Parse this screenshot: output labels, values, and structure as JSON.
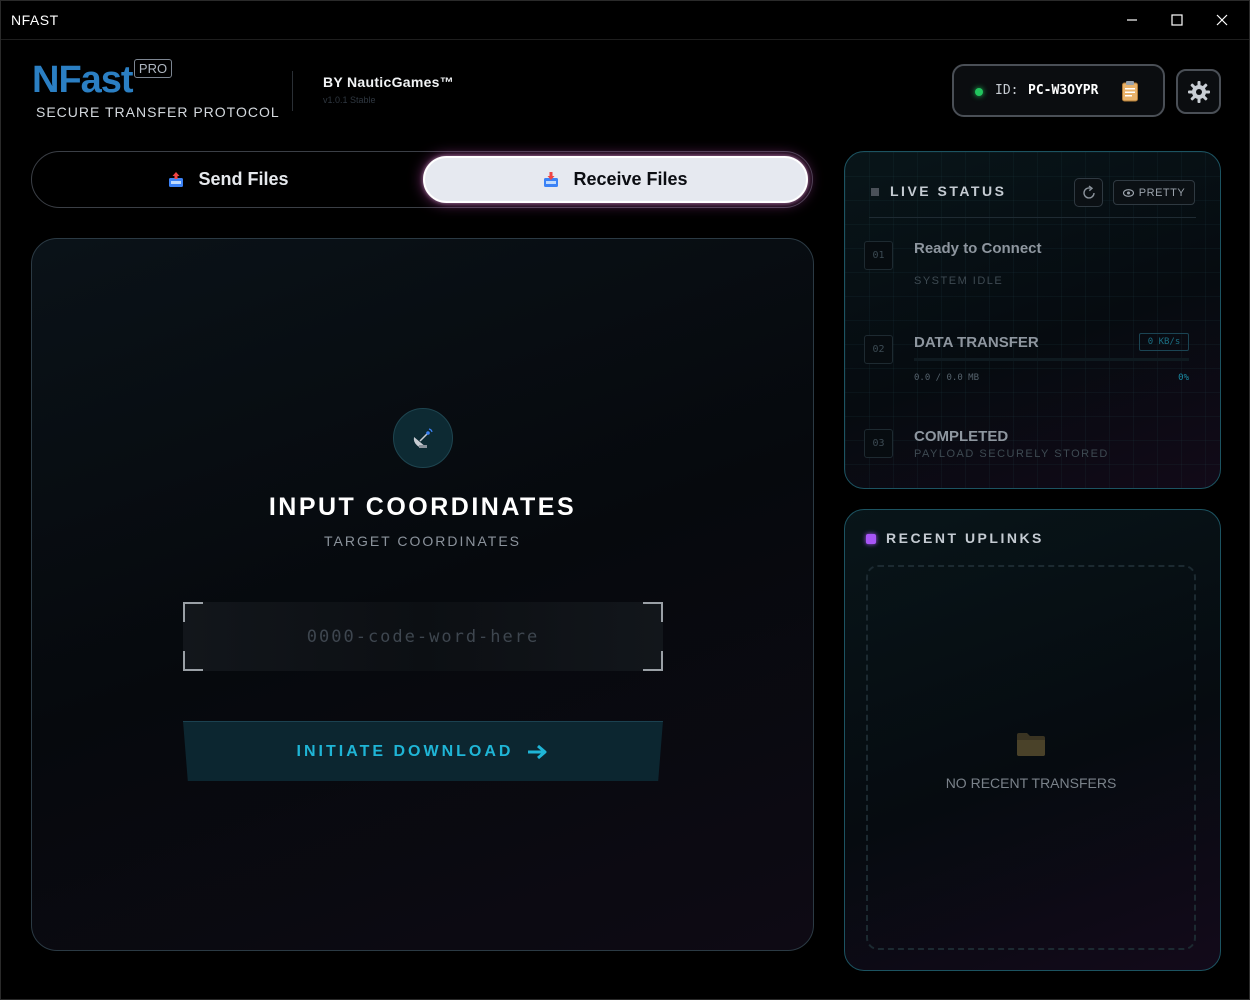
{
  "window": {
    "title": "NFAST"
  },
  "header": {
    "brand": "NFast",
    "badge": "PRO",
    "subtitle": "SECURE TRANSFER PROTOCOL",
    "byline": "BY NauticGames™",
    "version": "v1.0.1 Stable",
    "device_id_label": "ID:",
    "device_id": "PC-W3OYPR",
    "status_color": "#22c55e"
  },
  "tabs": [
    {
      "label": "Send Files",
      "active": false
    },
    {
      "label": "Receive Files",
      "active": true
    }
  ],
  "receive": {
    "title": "INPUT COORDINATES",
    "subtitle": "TARGET COORDINATES",
    "code_placeholder": "0000-code-word-here",
    "code_value": "",
    "button_label": "INITIATE DOWNLOAD"
  },
  "live_status": {
    "title": "LIVE STATUS",
    "pretty_label": "PRETTY",
    "steps": [
      {
        "num": "01",
        "title": "Ready to Connect",
        "sub": "SYSTEM IDLE"
      },
      {
        "num": "02",
        "title": "DATA TRANSFER",
        "speed": "0 KB/s",
        "size": "0.0 / 0.0 MB",
        "percent": "0%",
        "progress": 0
      },
      {
        "num": "03",
        "title": "COMPLETED",
        "sub": "PAYLOAD SECURELY STORED"
      }
    ]
  },
  "recent": {
    "title": "RECENT UPLINKS",
    "empty_text": "NO RECENT TRANSFERS"
  },
  "colors": {
    "accent": "#1fb5d6",
    "brand": "#2b7fc3",
    "recent_marker": "#a855f7"
  }
}
